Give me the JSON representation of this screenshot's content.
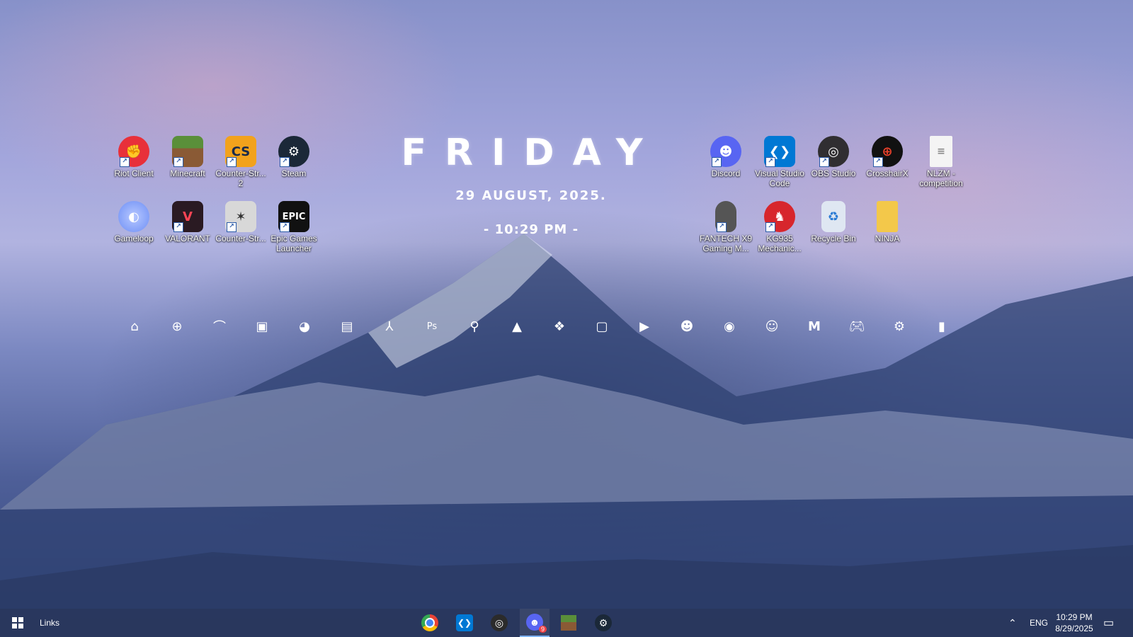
{
  "desktop": {
    "left_icons": [
      {
        "label": "Riot Client",
        "icon": "riot-client-icon",
        "color": "#e8303a"
      },
      {
        "label": "Minecraft",
        "icon": "minecraft-icon",
        "color": "#5a8f3a"
      },
      {
        "label": "Counter-Str... 2",
        "icon": "counter-strike-2-icon",
        "color": "#f2a21c"
      },
      {
        "label": "Steam",
        "icon": "steam-icon",
        "color": "#1b2838"
      },
      {
        "label": "Gameloop",
        "icon": "gameloop-icon",
        "color": "#6d8ef5"
      },
      {
        "label": "VALORANT",
        "icon": "valorant-icon",
        "color": "#fa4454"
      },
      {
        "label": "Counter-Str...",
        "icon": "counter-strike-icon",
        "color": "#c9c9c9"
      },
      {
        "label": "Epic Games Launcher",
        "icon": "epic-games-icon",
        "color": "#111111"
      }
    ],
    "right_icons": [
      {
        "label": "Discord",
        "icon": "discord-icon",
        "color": "#5865f2"
      },
      {
        "label": "Visual Studio Code",
        "icon": "vscode-icon",
        "color": "#0078d4"
      },
      {
        "label": "OBS Studio",
        "icon": "obs-studio-icon",
        "color": "#302e31"
      },
      {
        "label": "CrosshairX",
        "icon": "crosshairx-icon",
        "color": "#e8402a"
      },
      {
        "label": "NLZM - competition",
        "icon": "text-file-icon",
        "color": "#f4f4f4"
      },
      {
        "label": "FANTECH X9 Gaming M...",
        "icon": "mouse-icon",
        "color": "#555555"
      },
      {
        "label": "KG935 Mechanic...",
        "icon": "redragon-icon",
        "color": "#d7262c"
      },
      {
        "label": "Recycle Bin",
        "icon": "recycle-bin-icon",
        "color": "#dfe7f2"
      },
      {
        "label": "NINJA",
        "icon": "folder-icon",
        "color": "#f3c84a"
      }
    ]
  },
  "widget": {
    "day": "FRIDAY",
    "date": "29 AUGUST, 2025.",
    "time": "- 10:29 PM -"
  },
  "dock_icons": [
    "home-icon",
    "download-icon",
    "tube-icon",
    "gallery-icon",
    "firefox-icon",
    "office-icon",
    "acrobat-icon",
    "photoshop-icon",
    "maps-pin-icon",
    "vlc-icon",
    "kodi-icon",
    "twitch-icon",
    "youtube-icon",
    "discord-icon",
    "spotify-icon",
    "reddit-icon",
    "gmail-icon",
    "gamepad-icon",
    "settings-icon",
    "trash-icon"
  ],
  "taskbar": {
    "links_label": "Links",
    "apps": [
      {
        "name": "chrome-icon",
        "color": "#ea4335"
      },
      {
        "name": "vscode-icon",
        "color": "#0078d4"
      },
      {
        "name": "obs-studio-icon",
        "color": "#2b2b2b"
      },
      {
        "name": "discord-icon",
        "color": "#5865f2",
        "badge": "9"
      },
      {
        "name": "minecraft-icon",
        "color": "#5a8f3a"
      },
      {
        "name": "steam-icon",
        "color": "#1b2838"
      }
    ],
    "language": "ENG",
    "clock_time": "10:29 PM",
    "clock_date": "8/29/2025"
  }
}
